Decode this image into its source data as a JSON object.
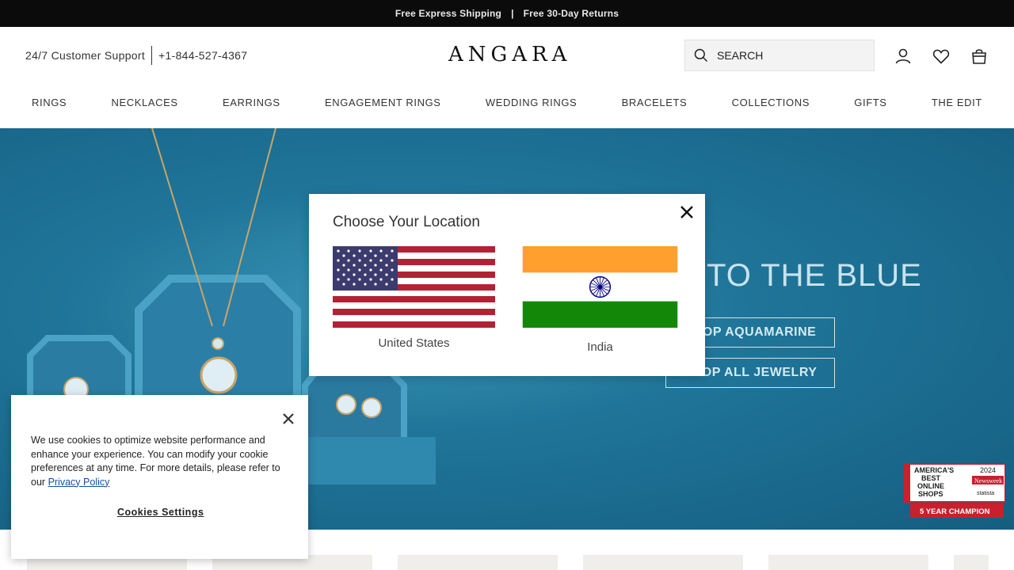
{
  "topbar": {
    "shipping": "Free Express Shipping",
    "sep": "|",
    "returns": "Free 30-Day Returns"
  },
  "header": {
    "support_label": "24/7 Customer Support",
    "phone": "+1-844-527-4367",
    "logo": "ANGARA",
    "search_placeholder": "SEARCH",
    "icons": [
      "search-icon",
      "user-icon",
      "heart-icon",
      "bag-icon"
    ]
  },
  "nav": [
    "RINGS",
    "NECKLACES",
    "EARRINGS",
    "ENGAGEMENT RINGS",
    "WEDDING RINGS",
    "BRACELETS",
    "COLLECTIONS",
    "GIFTS",
    "THE EDIT"
  ],
  "hero": {
    "title": "INTO THE BLUE",
    "btn_aquamarine": "SHOP AQUAMARINE",
    "btn_all": "SHOP ALL JEWELRY",
    "badge": {
      "line1": "AMERICA'S",
      "line2": "BEST",
      "line3": "ONLINE",
      "line4": "SHOPS",
      "year": "2024",
      "brand": "Newsweek",
      "partner": "statista",
      "champion": "5 YEAR CHAMPION"
    }
  },
  "location_modal": {
    "title": "Choose Your Location",
    "options": [
      {
        "label": "United States",
        "flag": "us-flag"
      },
      {
        "label": "India",
        "flag": "india-flag"
      }
    ]
  },
  "cookie_banner": {
    "text": "We use cookies to optimize website performance and enhance your experience. You can modify your cookie preferences at any time. For more details, please refer to our",
    "link": "Privacy Policy",
    "settings": "Cookies Settings"
  },
  "colors": {
    "topbar": "#0b0b0b",
    "hero_blue": "#1f7599",
    "us_red": "#b22234",
    "us_blue": "#3c3b6e",
    "india_saffron": "#ff9f2e",
    "india_green": "#138808",
    "chakra": "#000080"
  }
}
